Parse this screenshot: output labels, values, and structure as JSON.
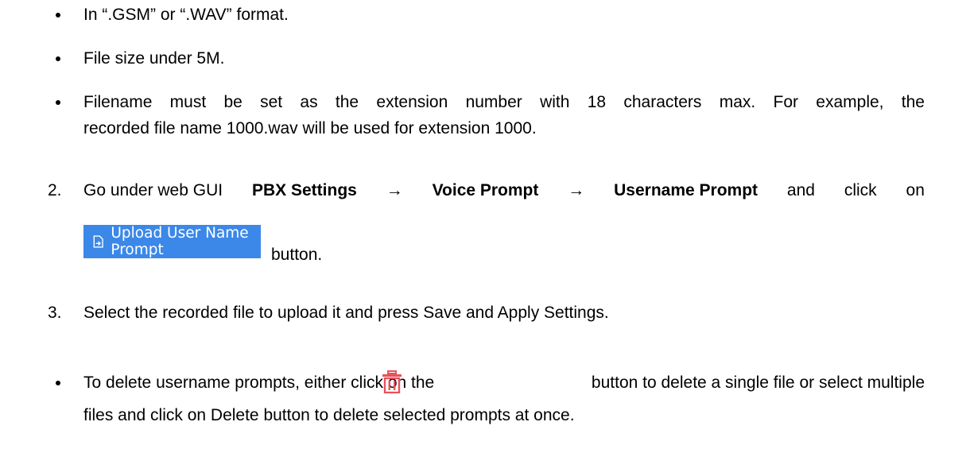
{
  "format_req": {
    "text": "In “.GSM” or “.WAV” format."
  },
  "size_req": {
    "text": "File size under 5M."
  },
  "filename_req": {
    "line1": "Filename must be set as the extension number with 18 characters max. For example, the",
    "line2": "recorded file name 1000.wav will be used for extension 1000."
  },
  "step2": {
    "number": "2.",
    "go_under": "Go under web GUI",
    "crumb1": "PBX Settings",
    "crumb2": "Voice Prompt",
    "crumb3": "Username Prompt",
    "arrow": "→",
    "click_on": "and click on",
    "button_label": "Upload User Name Prompt",
    "button_word": "button."
  },
  "step3": {
    "number": "3.",
    "text": "Select the recorded file to upload it and press Save and Apply Settings."
  },
  "delete_note": {
    "before_icon": "To delete username prompts, either click on the",
    "after_icon": "button to delete a single file or select multiple",
    "line2": "files and click on Delete button to delete selected prompts at once."
  },
  "colors": {
    "upload_button_bg": "#3b88e8",
    "trash_icon": "#e8525a"
  },
  "icons": [
    "upload-icon",
    "trash-icon"
  ]
}
